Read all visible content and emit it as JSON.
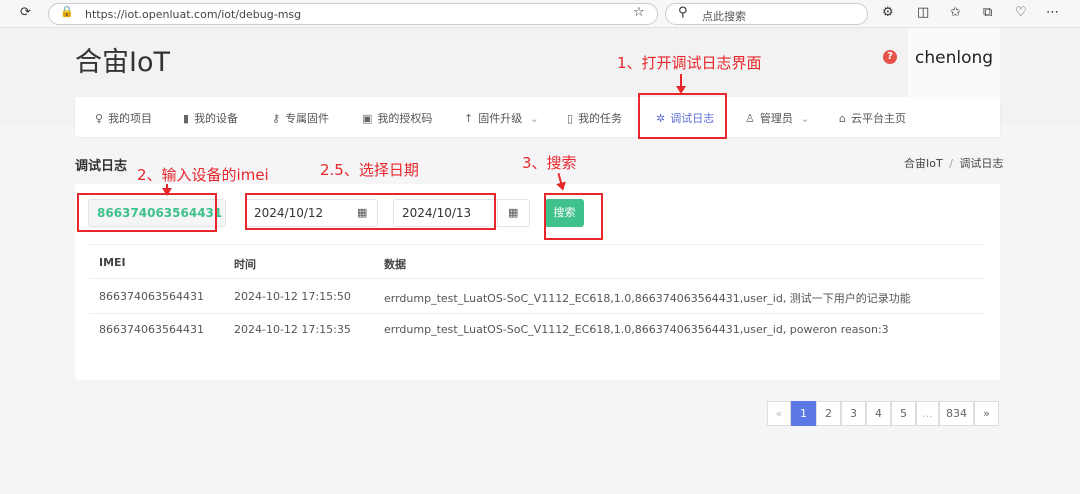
{
  "browser": {
    "url": "https://iot.openluat.com/iot/debug-msg",
    "search_placeholder": "点此搜索"
  },
  "header": {
    "logo": "合宙IoT",
    "user": "chenlong",
    "help_icon": "?"
  },
  "nav": [
    {
      "label": "我的项目",
      "icon": "lightbulb-icon"
    },
    {
      "label": "我的设备",
      "icon": "chip-icon"
    },
    {
      "label": "专属固件",
      "icon": "key-icon"
    },
    {
      "label": "我的授权码",
      "icon": "card-icon"
    },
    {
      "label": "固件升级",
      "icon": "arrow-up-icon",
      "dropdown": true
    },
    {
      "label": "我的任务",
      "icon": "clipboard-icon"
    },
    {
      "label": "调试日志",
      "icon": "bug-icon",
      "active": true
    },
    {
      "label": "管理员",
      "icon": "user-icon",
      "dropdown": true
    },
    {
      "label": "云平台主页",
      "icon": "home-icon"
    }
  ],
  "annotations": {
    "a1": "1、打开调试日志界面",
    "a2": "2、输入设备的imei",
    "a25": "2.5、选择日期",
    "a3": "3、搜索"
  },
  "page": {
    "title": "调试日志",
    "breadcrumb": [
      "合宙IoT",
      "调试日志"
    ],
    "sep": "/"
  },
  "form": {
    "imei": "866374063564431",
    "start_date": "2024/10/12",
    "end_date": "2024/10/13",
    "search_label": "搜索"
  },
  "table": {
    "headers": [
      "IMEI",
      "时间",
      "数据"
    ],
    "rows": [
      [
        "866374063564431",
        "2024-10-12 17:15:50",
        "errdump_test_LuatOS-SoC_V1112_EC618,1.0,866374063564431,user_id, 测试一下用户的记录功能"
      ],
      [
        "866374063564431",
        "2024-10-12 17:15:35",
        "errdump_test_LuatOS-SoC_V1112_EC618,1.0,866374063564431,user_id, poweron reason:3"
      ]
    ]
  },
  "pagination": {
    "prev": "«",
    "pages": [
      "1",
      "2",
      "3",
      "4",
      "5",
      "...",
      "834"
    ],
    "current": "1",
    "next": "»"
  },
  "colors": {
    "accent": "#5b78e5",
    "success": "#3ec18a",
    "annotation": "#e8272c"
  }
}
